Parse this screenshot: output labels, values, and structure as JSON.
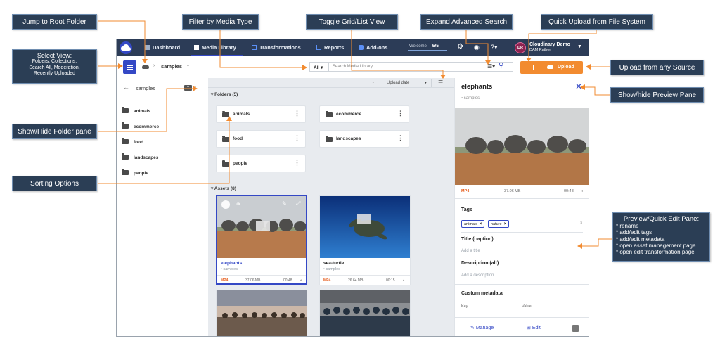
{
  "colors": {
    "nav_bg": "#2c3c57",
    "accent": "#3448c5",
    "upload_orange": "#f28b30",
    "callout_bg": "#2b3e55",
    "arrow_orange": "#f28b30"
  },
  "nav": {
    "items": [
      {
        "label": "Dashboard",
        "icon": "dashboard-icon"
      },
      {
        "label": "Media Library",
        "icon": "media-library-icon"
      },
      {
        "label": "Transformations",
        "icon": "transformations-icon"
      },
      {
        "label": "Reports",
        "icon": "reports-icon"
      },
      {
        "label": "Add-ons",
        "icon": "addons-icon"
      }
    ],
    "welcome_label": "Welcome",
    "welcome_progress": "5/5",
    "avatar_initials": "DR",
    "account_name": "Cloudinary Demo",
    "account_sub": "DAM Rather"
  },
  "toolbar": {
    "breadcrumb": "samples",
    "filter_value": "All",
    "search_placeholder": "Search Media Library",
    "upload_label": "Upload"
  },
  "folder_pane": {
    "title": "samples",
    "folders": [
      "animals",
      "ecommerce",
      "food",
      "landscapes",
      "people"
    ]
  },
  "main": {
    "sort_field": "Upload date",
    "folders_heading": "Folders (5)",
    "folders": [
      "animals",
      "ecommerce",
      "food",
      "landscapes",
      "people"
    ],
    "assets_heading": "Assets (8)",
    "assets": [
      {
        "name": "elephants",
        "folder": "samples",
        "type": "MP4",
        "size": "37.06 MB",
        "duration": "00:48"
      },
      {
        "name": "sea-turtle",
        "folder": "samples",
        "type": "MP4",
        "size": "26.64 MB",
        "duration": "00:15"
      }
    ]
  },
  "preview": {
    "title": "elephants",
    "folder": "samples",
    "type": "MP4",
    "size": "37.06 MB",
    "duration": "00:48",
    "tags_label": "Tags",
    "tags": [
      "animals",
      "nature"
    ],
    "caption_label": "Title (caption)",
    "caption_placeholder": "Add a title",
    "description_label": "Description (alt)",
    "description_placeholder": "Add a description",
    "custom_metadata_label": "Custom metadata",
    "key_label": "Key",
    "value_label": "Value",
    "manage_label": "Manage",
    "edit_label": "Edit"
  },
  "annotations": {
    "jump_root": "Jump to Root Folder",
    "filter_media": "Filter by Media Type",
    "toggle_view": "Toggle Grid/List View",
    "expand_search": "Expand Advanced Search",
    "quick_upload": "Quick Upload from File System",
    "select_view": [
      "Select View:",
      "Folders, Collections,",
      "Search All,  Moderation,",
      "Recently Uploaded"
    ],
    "upload_any": "Upload from any Source",
    "show_hide_preview": "Show/hide  Preview Pane",
    "show_hide_folder": "Show/Hide Folder pane",
    "sorting": "Sorting Options",
    "preview_edit": [
      "Preview/Quick Edit Pane:",
      "* rename",
      "* add/edit tags",
      "* add/edit metadata",
      "* open asset management page",
      "* open edit transformation page"
    ]
  }
}
